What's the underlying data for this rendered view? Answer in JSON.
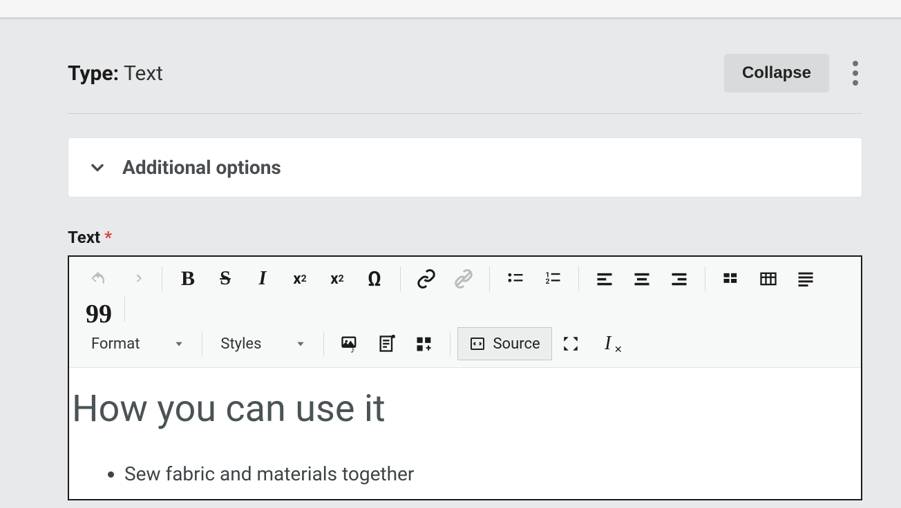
{
  "header": {
    "type_prefix": "Type:",
    "type_value": "Text",
    "collapse_label": "Collapse"
  },
  "options_panel": {
    "label": "Additional options"
  },
  "field": {
    "label": "Text",
    "required_mark": "*"
  },
  "toolbar": {
    "format_label": "Format",
    "styles_label": "Styles",
    "source_label": "Source"
  },
  "editor": {
    "heading": "How you can use it",
    "bullets": [
      "Sew fabric and materials together"
    ]
  }
}
